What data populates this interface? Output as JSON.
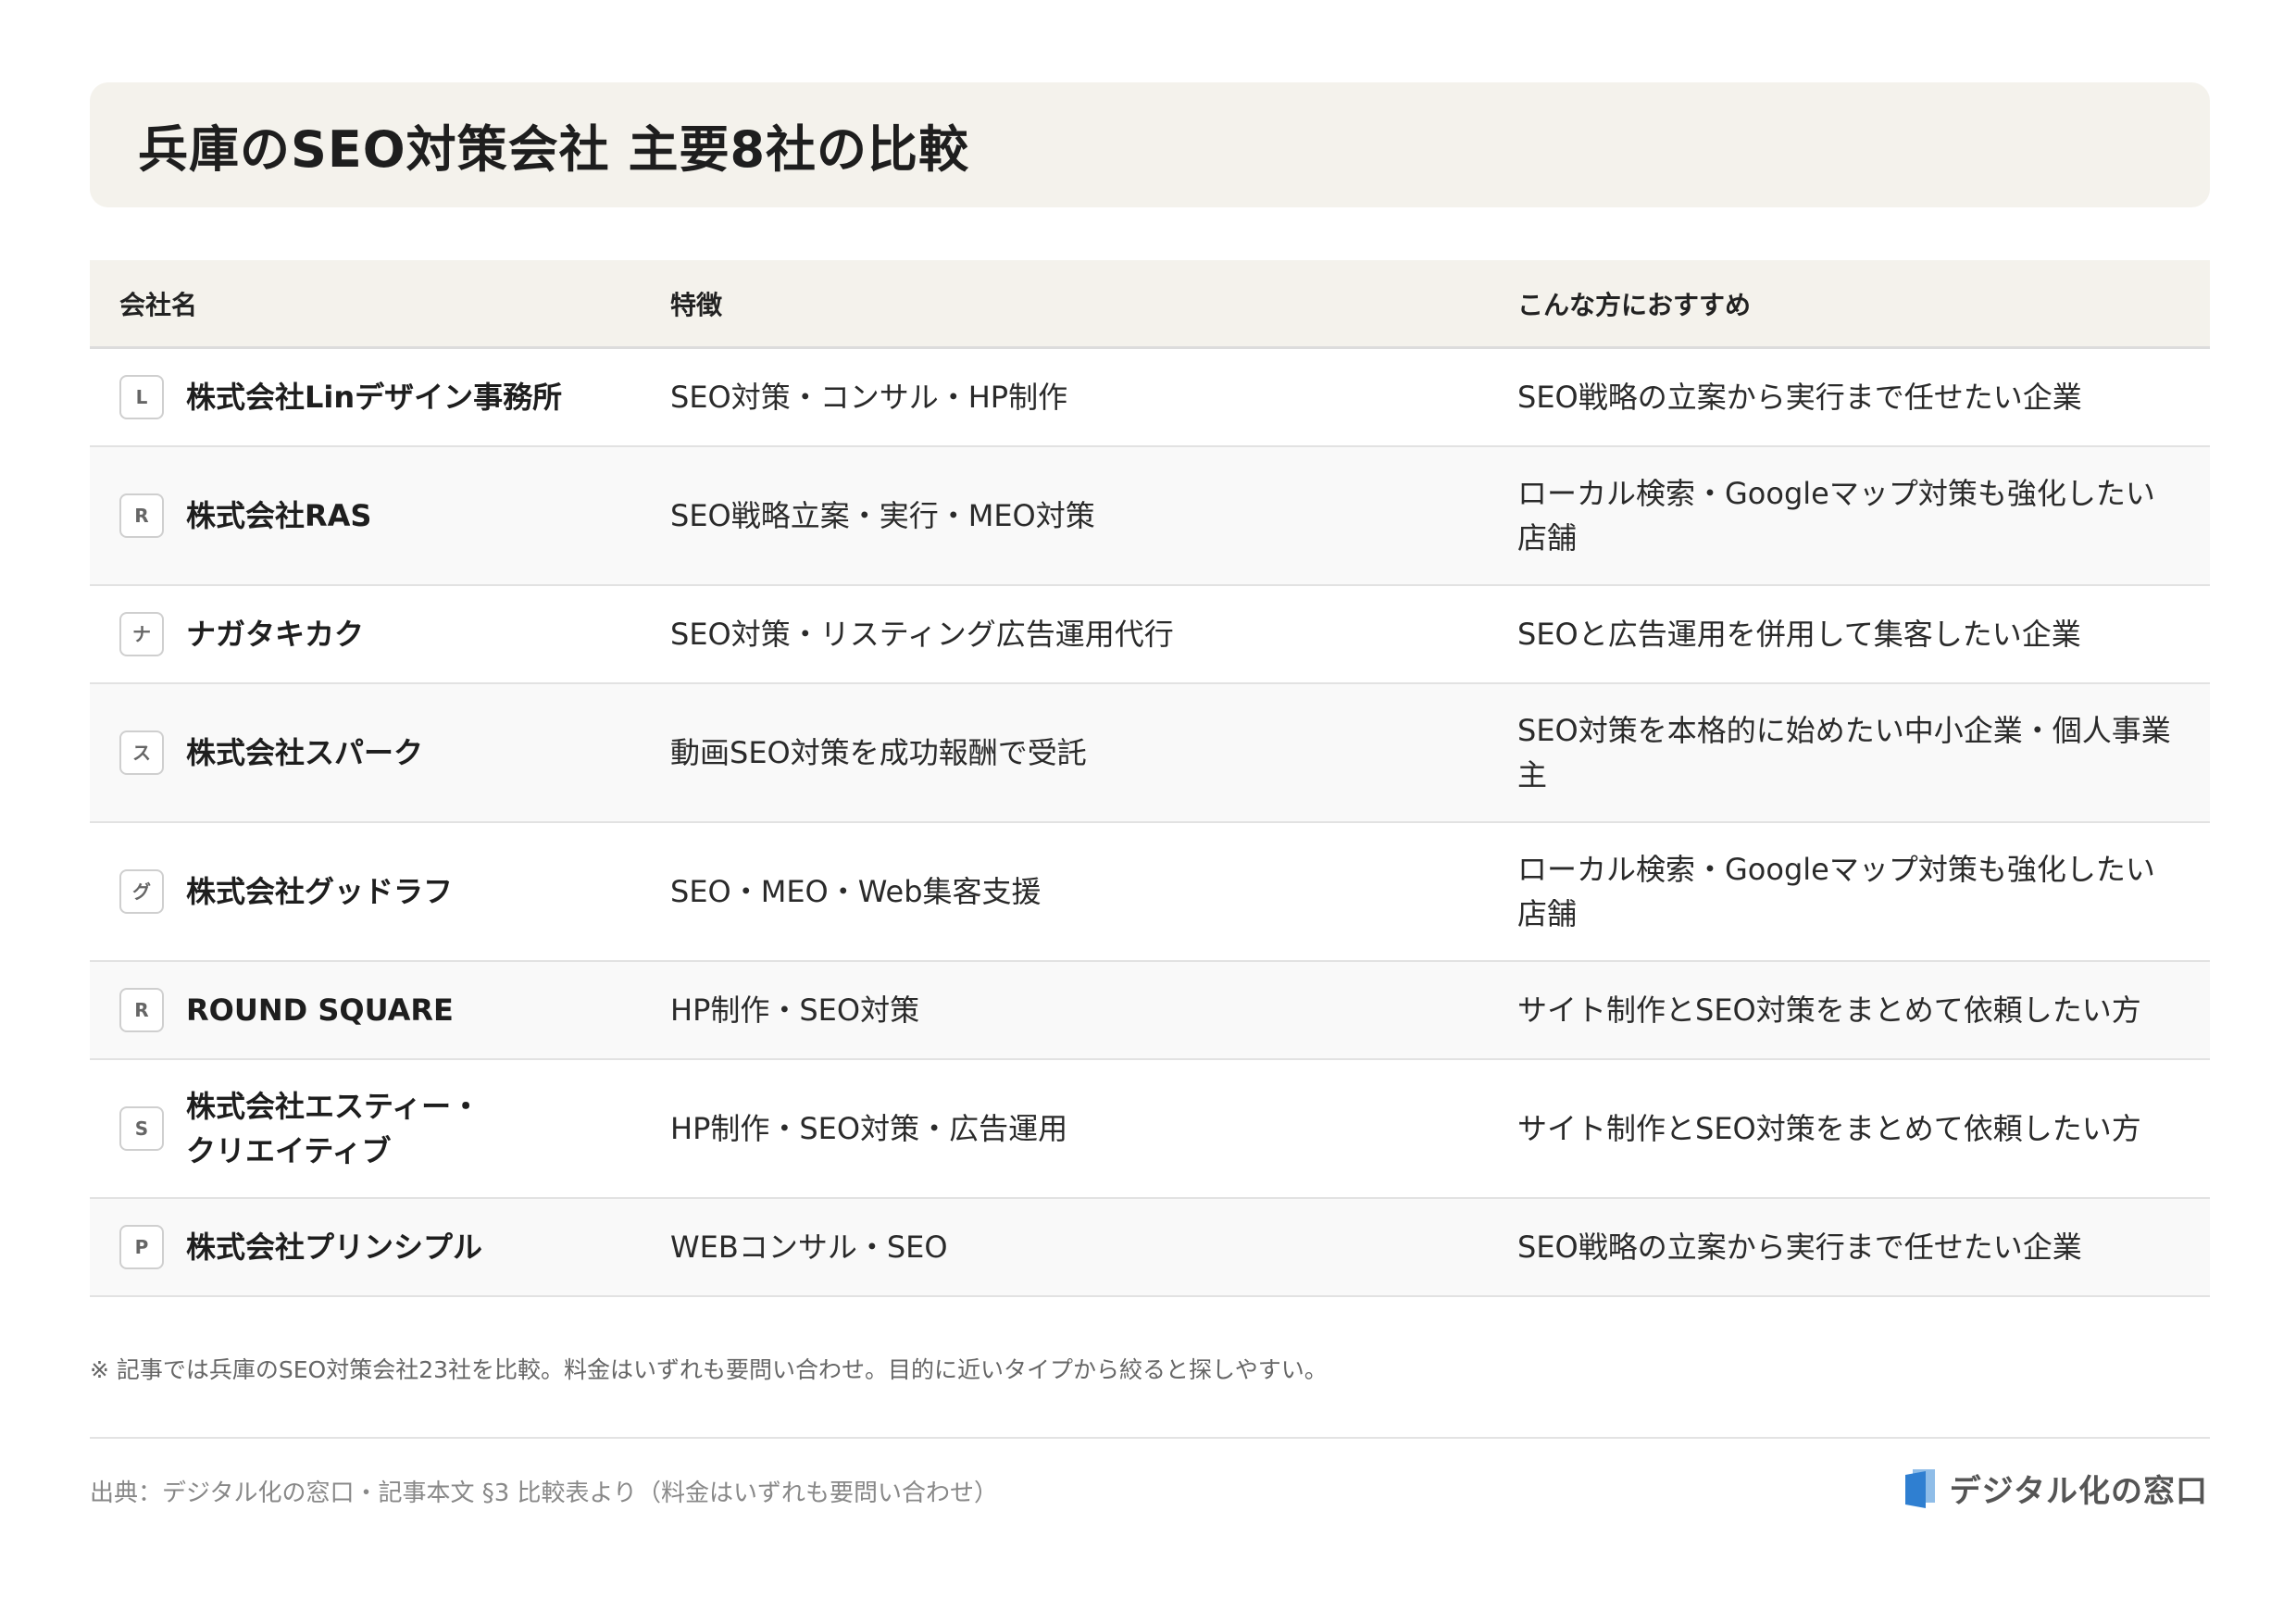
{
  "title": "兵庫のSEO対策会社 主要8社の比較",
  "table": {
    "headers": {
      "company": "会社名",
      "feature": "特徴",
      "recommend": "こんな方におすすめ"
    },
    "rows": [
      {
        "badge": "L",
        "company": "株式会社Linデザイン事務所",
        "feature": "SEO対策・コンサル・HP制作",
        "recommend": "SEO戦略の立案から実行まで任せたい企業"
      },
      {
        "badge": "R",
        "company": "株式会社RAS",
        "feature": "SEO戦略立案・実行・MEO対策",
        "recommend": "ローカル検索・Googleマップ対策も強化したい店舗"
      },
      {
        "badge": "ナ",
        "company": "ナガタキカク",
        "feature": "SEO対策・リスティング広告運用代行",
        "recommend": "SEOと広告運用を併用して集客したい企業"
      },
      {
        "badge": "ス",
        "company": "株式会社スパーク",
        "feature": "動画SEO対策を成功報酬で受託",
        "recommend": "SEO対策を本格的に始めたい中小企業・個人事業主"
      },
      {
        "badge": "グ",
        "company": "株式会社グッドラフ",
        "feature": "SEO・MEO・Web集客支援",
        "recommend": "ローカル検索・Googleマップ対策も強化したい店舗"
      },
      {
        "badge": "R",
        "company": "ROUND SQUARE",
        "feature": "HP制作・SEO対策",
        "recommend": "サイト制作とSEO対策をまとめて依頼したい方"
      },
      {
        "badge": "S",
        "company": "株式会社エスティー・クリエイティブ",
        "feature": "HP制作・SEO対策・広告運用",
        "recommend": "サイト制作とSEO対策をまとめて依頼したい方"
      },
      {
        "badge": "P",
        "company": "株式会社プリンシプル",
        "feature": "WEBコンサル・SEO",
        "recommend": "SEO戦略の立案から実行まで任せたい企業"
      }
    ]
  },
  "note": "※ 記事では兵庫のSEO対策会社23社を比較。料金はいずれも要問い合わせ。目的に近いタイプから絞ると探しやすい。",
  "source": "出典：デジタル化の窓口・記事本文 §3 比較表より（料金はいずれも要問い合わせ）",
  "brand": {
    "name": "デジタル化の窓口",
    "icon": "document-logo-icon",
    "color": "#2f7fd1"
  }
}
